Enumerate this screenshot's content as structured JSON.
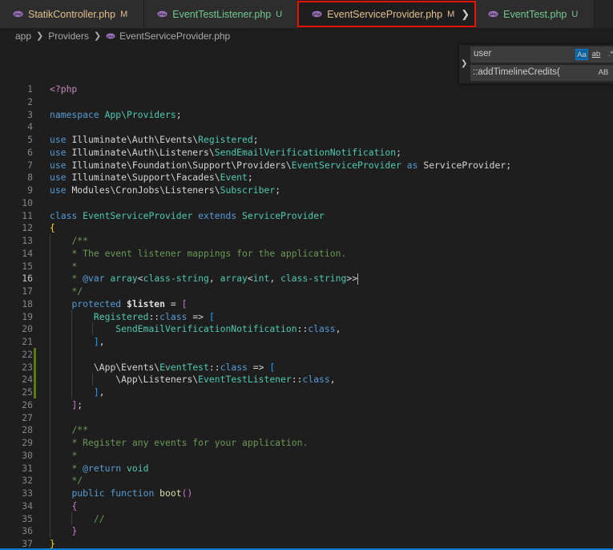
{
  "tabs": [
    {
      "label": "StatikController.php",
      "badge": "M",
      "color": "#e2c08d",
      "active": false
    },
    {
      "label": "EventTestListener.php",
      "badge": "U",
      "color": "#73c991",
      "active": false
    },
    {
      "label": "EventServiceProvider.php",
      "badge": "M",
      "color": "#e2c08d",
      "active": true
    },
    {
      "label": "EventTest.php",
      "badge": "U",
      "color": "#73c991",
      "active": false
    }
  ],
  "breadcrumb": {
    "items": [
      "app",
      "Providers",
      "EventServiceProvider.php"
    ]
  },
  "find": {
    "search_value": "user",
    "replace_value": "::addTimelineCredits(",
    "match_case_label": "Aa",
    "whole_word_label": "ab",
    "regex_label": ".*",
    "preserve_case_label": "AB"
  },
  "current_line": 16,
  "lines": [
    {
      "n": 1,
      "tokens": [
        [
          "purple",
          "<?php"
        ]
      ]
    },
    {
      "n": 2,
      "tokens": []
    },
    {
      "n": 3,
      "tokens": [
        [
          "kw",
          "namespace "
        ],
        [
          "cls",
          "App\\Providers"
        ],
        [
          "op",
          ";"
        ]
      ]
    },
    {
      "n": 4,
      "tokens": []
    },
    {
      "n": 5,
      "tokens": [
        [
          "kw",
          "use "
        ],
        [
          "ns",
          "Illuminate\\Auth\\Events\\"
        ],
        [
          "cls",
          "Registered"
        ],
        [
          "op",
          ";"
        ]
      ]
    },
    {
      "n": 6,
      "tokens": [
        [
          "kw",
          "use "
        ],
        [
          "ns",
          "Illuminate\\Auth\\Listeners\\"
        ],
        [
          "cls",
          "SendEmailVerificationNotification"
        ],
        [
          "op",
          ";"
        ]
      ]
    },
    {
      "n": 7,
      "tokens": [
        [
          "kw",
          "use "
        ],
        [
          "ns",
          "Illuminate\\Foundation\\Support\\Providers\\"
        ],
        [
          "cls",
          "EventServiceProvider"
        ],
        [
          "kw",
          " as "
        ],
        [
          "ns",
          "ServiceProvider"
        ],
        [
          "op",
          ";"
        ]
      ]
    },
    {
      "n": 8,
      "tokens": [
        [
          "kw",
          "use "
        ],
        [
          "ns",
          "Illuminate\\Support\\Facades\\"
        ],
        [
          "cls",
          "Event"
        ],
        [
          "op",
          ";"
        ]
      ]
    },
    {
      "n": 9,
      "tokens": [
        [
          "kw",
          "use "
        ],
        [
          "ns",
          "Modules\\CronJobs\\Listeners\\"
        ],
        [
          "cls",
          "Subscriber"
        ],
        [
          "op",
          ";"
        ]
      ]
    },
    {
      "n": 10,
      "tokens": []
    },
    {
      "n": 11,
      "tokens": [
        [
          "kw",
          "class "
        ],
        [
          "cls",
          "EventServiceProvider"
        ],
        [
          "kw",
          " extends "
        ],
        [
          "cls",
          "ServiceProvider"
        ]
      ]
    },
    {
      "n": 12,
      "tokens": [
        [
          "br1",
          "{"
        ]
      ]
    },
    {
      "n": 13,
      "tokens": [
        [
          "op",
          "    "
        ],
        [
          "cm",
          "/**"
        ]
      ]
    },
    {
      "n": 14,
      "tokens": [
        [
          "op",
          "    "
        ],
        [
          "cm",
          "* The event listener mappings for the application."
        ]
      ]
    },
    {
      "n": 15,
      "tokens": [
        [
          "op",
          "    "
        ],
        [
          "cm",
          "*"
        ]
      ]
    },
    {
      "n": 16,
      "tokens": [
        [
          "op",
          "    "
        ],
        [
          "cm",
          "* "
        ],
        [
          "kw",
          "@var "
        ],
        [
          "cls",
          "array"
        ],
        [
          "op",
          "<"
        ],
        [
          "cls",
          "class-string"
        ],
        [
          "op",
          ", "
        ],
        [
          "cls",
          "array"
        ],
        [
          "op",
          "<"
        ],
        [
          "cls",
          "int"
        ],
        [
          "op",
          ", "
        ],
        [
          "cls",
          "class-string"
        ],
        [
          "op",
          ">>"
        ]
      ]
    },
    {
      "n": 17,
      "tokens": [
        [
          "op",
          "    "
        ],
        [
          "cm",
          "*/"
        ]
      ]
    },
    {
      "n": 18,
      "tokens": [
        [
          "op",
          "    "
        ],
        [
          "kw",
          "protected "
        ],
        [
          "var",
          "$listen"
        ],
        [
          "op",
          " = "
        ],
        [
          "br2",
          "["
        ]
      ]
    },
    {
      "n": 19,
      "tokens": [
        [
          "op",
          "        "
        ],
        [
          "cls",
          "Registered"
        ],
        [
          "op",
          "::"
        ],
        [
          "kw",
          "class"
        ],
        [
          "op",
          " => "
        ],
        [
          "br3",
          "["
        ]
      ]
    },
    {
      "n": 20,
      "tokens": [
        [
          "op",
          "            "
        ],
        [
          "cls",
          "SendEmailVerificationNotification"
        ],
        [
          "op",
          "::"
        ],
        [
          "kw",
          "class"
        ],
        [
          "op",
          ","
        ]
      ]
    },
    {
      "n": 21,
      "tokens": [
        [
          "op",
          "        "
        ],
        [
          "br3",
          "]"
        ],
        [
          "op",
          ","
        ]
      ]
    },
    {
      "n": 22,
      "tokens": []
    },
    {
      "n": 23,
      "tokens": [
        [
          "op",
          "        "
        ],
        [
          "ns",
          "\\App\\Events\\"
        ],
        [
          "cls",
          "EventTest"
        ],
        [
          "op",
          "::"
        ],
        [
          "kw",
          "class"
        ],
        [
          "op",
          " => "
        ],
        [
          "br3",
          "["
        ]
      ]
    },
    {
      "n": 24,
      "tokens": [
        [
          "op",
          "            "
        ],
        [
          "ns",
          "\\App\\Listeners\\"
        ],
        [
          "cls",
          "EventTestListener"
        ],
        [
          "op",
          "::"
        ],
        [
          "kw",
          "class"
        ],
        [
          "op",
          ","
        ]
      ]
    },
    {
      "n": 25,
      "tokens": [
        [
          "op",
          "        "
        ],
        [
          "br3",
          "]"
        ],
        [
          "op",
          ","
        ]
      ]
    },
    {
      "n": 26,
      "tokens": [
        [
          "op",
          "    "
        ],
        [
          "br2",
          "]"
        ],
        [
          "op",
          ";"
        ]
      ]
    },
    {
      "n": 27,
      "tokens": []
    },
    {
      "n": 28,
      "tokens": [
        [
          "op",
          "    "
        ],
        [
          "cm",
          "/**"
        ]
      ]
    },
    {
      "n": 29,
      "tokens": [
        [
          "op",
          "    "
        ],
        [
          "cm",
          "* Register any events for your application."
        ]
      ]
    },
    {
      "n": 30,
      "tokens": [
        [
          "op",
          "    "
        ],
        [
          "cm",
          "*"
        ]
      ]
    },
    {
      "n": 31,
      "tokens": [
        [
          "op",
          "    "
        ],
        [
          "cm",
          "* "
        ],
        [
          "kw",
          "@return "
        ],
        [
          "cls",
          "void"
        ]
      ]
    },
    {
      "n": 32,
      "tokens": [
        [
          "op",
          "    "
        ],
        [
          "cm",
          "*/"
        ]
      ]
    },
    {
      "n": 33,
      "tokens": [
        [
          "op",
          "    "
        ],
        [
          "kw",
          "public function "
        ],
        [
          "fn",
          "boot"
        ],
        [
          "br2",
          "()"
        ]
      ]
    },
    {
      "n": 34,
      "tokens": [
        [
          "op",
          "    "
        ],
        [
          "br2",
          "{"
        ]
      ]
    },
    {
      "n": 35,
      "tokens": [
        [
          "op",
          "        "
        ],
        [
          "cm",
          "//"
        ]
      ]
    },
    {
      "n": 36,
      "tokens": [
        [
          "op",
          "    "
        ],
        [
          "br2",
          "}"
        ]
      ]
    },
    {
      "n": 37,
      "tokens": [
        [
          "br1",
          "}"
        ]
      ]
    }
  ]
}
